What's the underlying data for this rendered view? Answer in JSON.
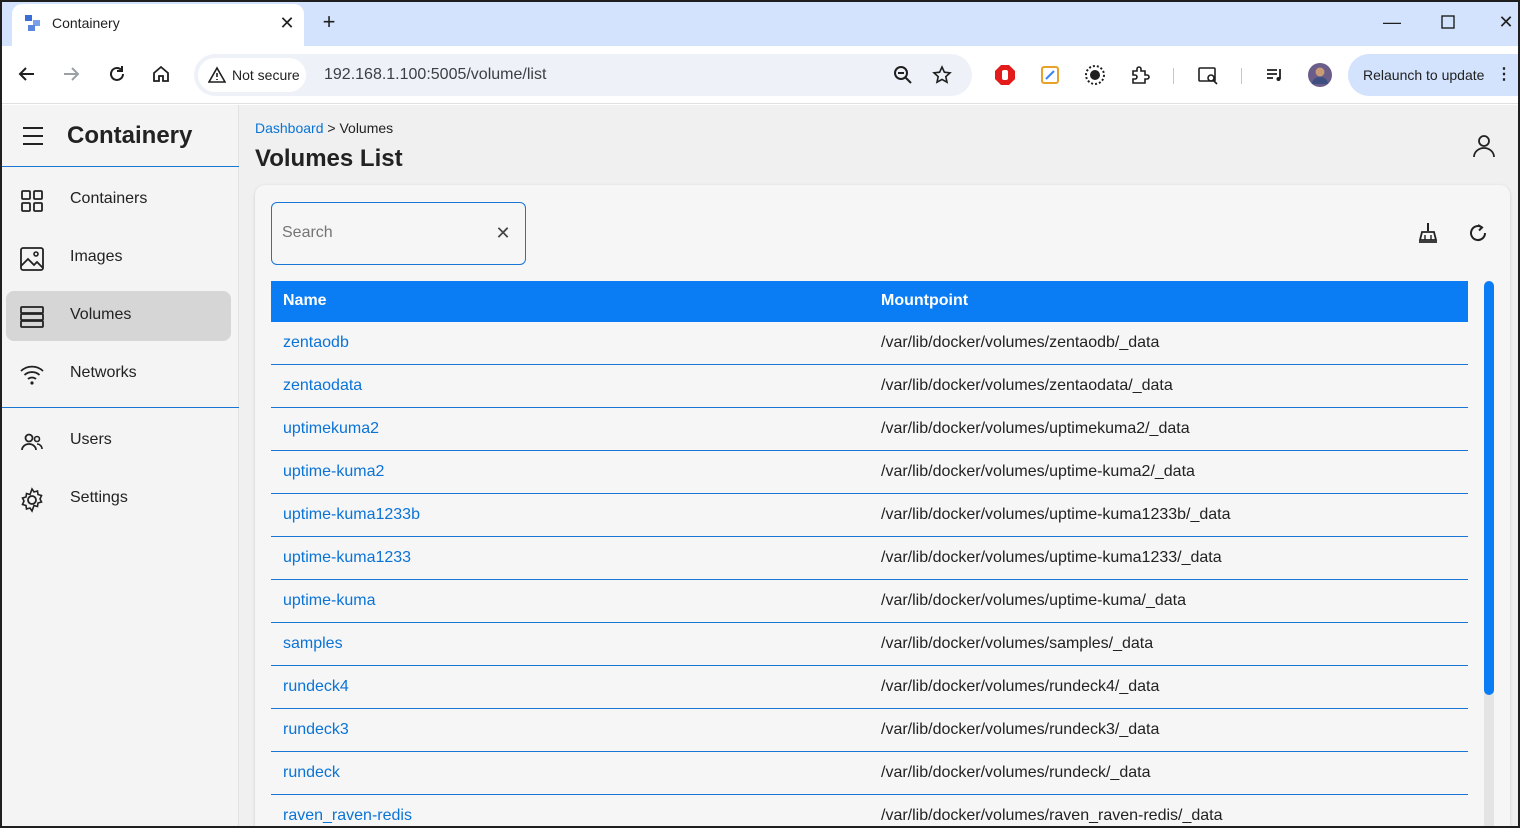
{
  "browser": {
    "tab_title": "Containery",
    "url_security": "Not secure",
    "url": "192.168.1.100:5005/volume/list",
    "relaunch_label": "Relaunch to update"
  },
  "sidebar": {
    "brand": "Containery",
    "items": [
      {
        "label": "Containers",
        "icon": "grid-icon",
        "active": false
      },
      {
        "label": "Images",
        "icon": "image-icon",
        "active": false
      },
      {
        "label": "Volumes",
        "icon": "storage-icon",
        "active": true
      },
      {
        "label": "Networks",
        "icon": "wifi-icon",
        "active": false
      }
    ],
    "items2": [
      {
        "label": "Users",
        "icon": "users-icon"
      },
      {
        "label": "Settings",
        "icon": "gear-icon"
      }
    ]
  },
  "breadcrumb": {
    "link": "Dashboard",
    "separator": ">",
    "current": "Volumes"
  },
  "page_title": "Volumes List",
  "search": {
    "placeholder": "Search",
    "value": ""
  },
  "table": {
    "columns": [
      "Name",
      "Mountpoint"
    ],
    "rows": [
      {
        "name": "zentaodb",
        "mountpoint": "/var/lib/docker/volumes/zentaodb/_data"
      },
      {
        "name": "zentaodata",
        "mountpoint": "/var/lib/docker/volumes/zentaodata/_data"
      },
      {
        "name": "uptimekuma2",
        "mountpoint": "/var/lib/docker/volumes/uptimekuma2/_data"
      },
      {
        "name": "uptime-kuma2",
        "mountpoint": "/var/lib/docker/volumes/uptime-kuma2/_data"
      },
      {
        "name": "uptime-kuma1233b",
        "mountpoint": "/var/lib/docker/volumes/uptime-kuma1233b/_data"
      },
      {
        "name": "uptime-kuma1233",
        "mountpoint": "/var/lib/docker/volumes/uptime-kuma1233/_data"
      },
      {
        "name": "uptime-kuma",
        "mountpoint": "/var/lib/docker/volumes/uptime-kuma/_data"
      },
      {
        "name": "samples",
        "mountpoint": "/var/lib/docker/volumes/samples/_data"
      },
      {
        "name": "rundeck4",
        "mountpoint": "/var/lib/docker/volumes/rundeck4/_data"
      },
      {
        "name": "rundeck3",
        "mountpoint": "/var/lib/docker/volumes/rundeck3/_data"
      },
      {
        "name": "rundeck",
        "mountpoint": "/var/lib/docker/volumes/rundeck/_data"
      },
      {
        "name": "raven_raven-redis",
        "mountpoint": "/var/lib/docker/volumes/raven_raven-redis/_data"
      }
    ]
  },
  "colors": {
    "accent": "#0a7cf4",
    "link": "#0a73d6",
    "active_nav": "#d6d6d6"
  }
}
